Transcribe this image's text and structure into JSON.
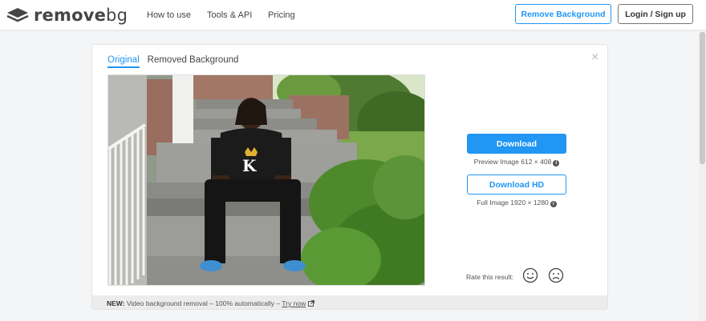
{
  "brand": {
    "name_main": "remove",
    "name_suffix": "bg"
  },
  "nav": {
    "links": [
      "How to use",
      "Tools & API",
      "Pricing"
    ],
    "remove_background": "Remove Background",
    "login": "Login / Sign up"
  },
  "card": {
    "tabs": [
      {
        "label": "Original",
        "active": true
      },
      {
        "label": "Removed Background",
        "active": false
      }
    ],
    "close_icon": "×",
    "download": {
      "label": "Download",
      "caption": "Preview Image 612 × 408",
      "hd_label": "Download HD",
      "hd_caption": "Full Image 1920 × 1280"
    },
    "rate": {
      "label": "Rate this result:"
    },
    "footer": {
      "new_label": "NEW:",
      "text": " Video background removal – 100% automatically – ",
      "link": "Try now"
    }
  },
  "colors": {
    "accent": "#2196f3",
    "text": "#454545",
    "background": "#f4f5f6"
  },
  "icons": [
    "logo-layers-icon",
    "close-icon",
    "info-icon",
    "smile-icon",
    "frown-icon",
    "external-link-icon"
  ]
}
